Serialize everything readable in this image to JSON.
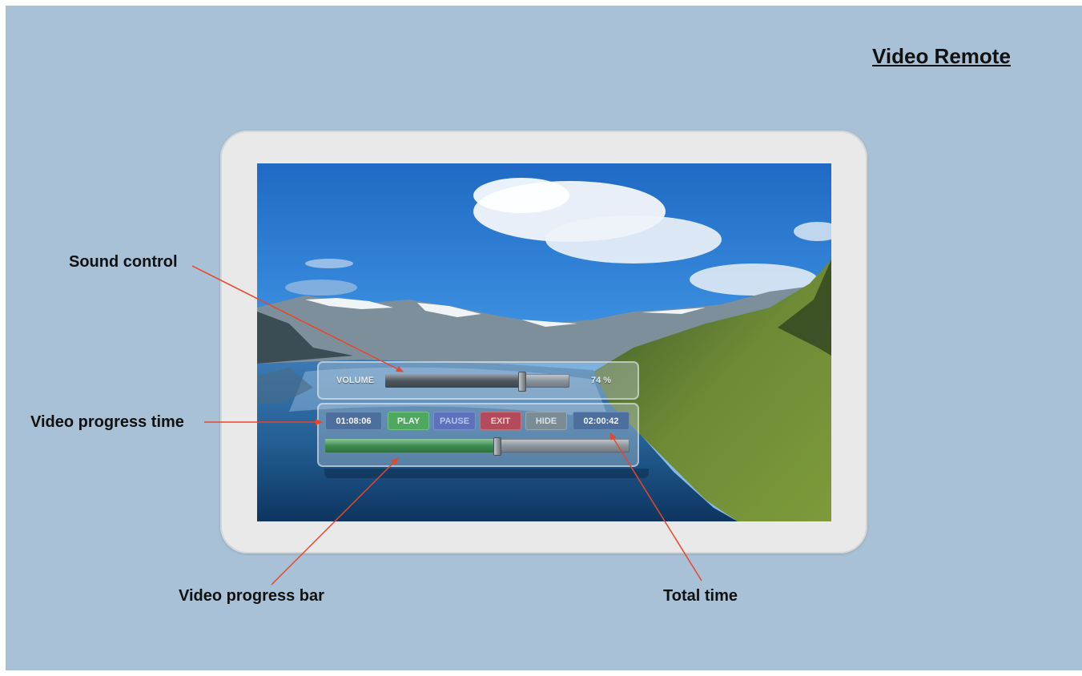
{
  "title": "Video Remote",
  "volume": {
    "label": "VOLUME",
    "value_text": "74 %",
    "level_percent": 74
  },
  "controls": {
    "current_time": "01:08:06",
    "play": "PLAY",
    "pause": "PAUSE",
    "exit": "EXIT",
    "hide": "HIDE",
    "total_time": "02:00:42"
  },
  "progress": {
    "fraction": 0.5641
  },
  "annotations": {
    "sound_control": "Sound control",
    "progress_time": "Video progress time",
    "progress_bar": "Video progress bar",
    "total_time": "Total time"
  },
  "colors": {
    "background": "#a9c1d6",
    "arrow": "#e8462a",
    "play": "#4ea860",
    "pause": "#5d71bd",
    "exit": "#b34b5a",
    "hide": "#7a8c96",
    "time": "#4d6f9e"
  }
}
